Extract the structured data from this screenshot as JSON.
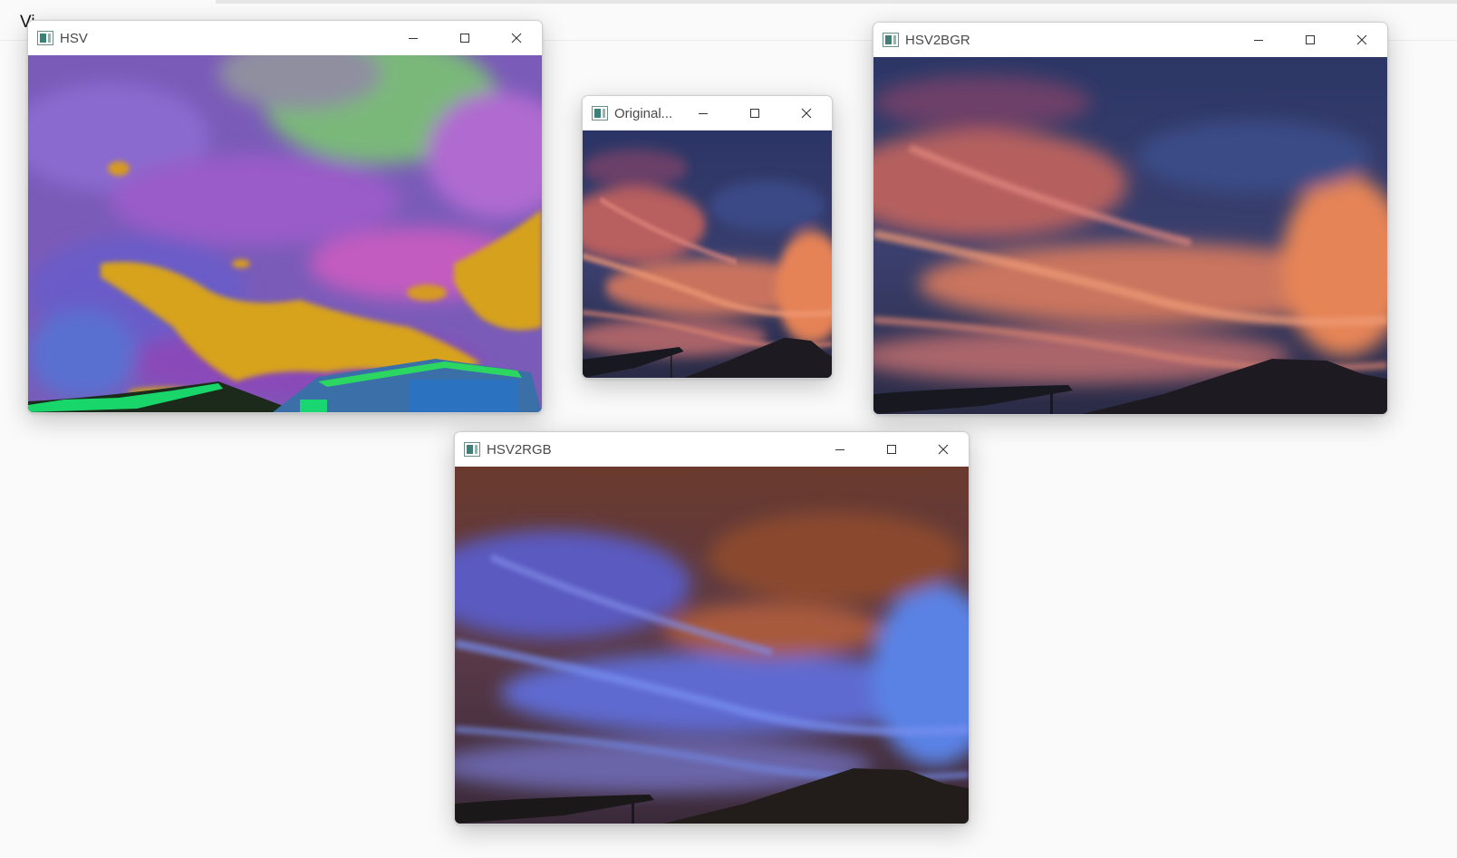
{
  "background": {
    "partial_text": "Vi"
  },
  "windows": {
    "hsv": {
      "title": "HSV"
    },
    "original": {
      "title": "Original..."
    },
    "hsv2bgr": {
      "title": "HSV2BGR"
    },
    "hsv2rgb": {
      "title": "HSV2RGB"
    }
  },
  "controls": {
    "minimize": "minimize-icon",
    "maximize": "maximize-icon",
    "close": "close-icon"
  },
  "colors": {
    "titlebar": "#ffffff",
    "title_text": "#4a4a4a",
    "desktop": "#fafafa"
  }
}
